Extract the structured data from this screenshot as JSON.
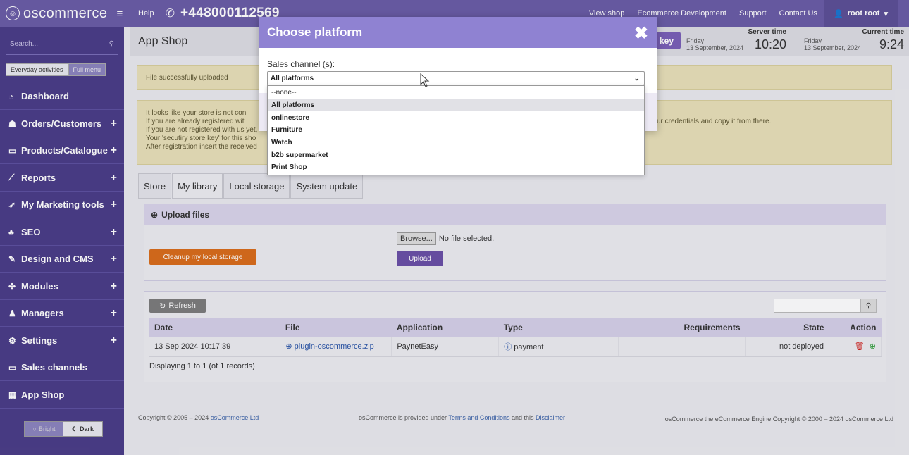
{
  "topbar": {
    "brand": "oscommerce",
    "help": "Help",
    "phone": "+448000112569",
    "links": [
      "View shop",
      "Ecommerce Development",
      "Support",
      "Contact Us"
    ],
    "user": "root root"
  },
  "sidebar": {
    "search_placeholder": "Search...",
    "menu_switch": {
      "active": "Everyday activities",
      "inactive": "Full menu"
    },
    "items": [
      {
        "label": "Dashboard",
        "icon": "dashboard-icon"
      },
      {
        "label": "Orders/Customers",
        "icon": "users-icon",
        "expandable": true
      },
      {
        "label": "Products/Catalogue",
        "icon": "folder-icon",
        "expandable": true
      },
      {
        "label": "Reports",
        "icon": "chart-line-icon",
        "expandable": true
      },
      {
        "label": "My Marketing tools",
        "icon": "rocket-icon",
        "expandable": true
      },
      {
        "label": "SEO",
        "icon": "sitemap-icon",
        "expandable": true
      },
      {
        "label": "Design and CMS",
        "icon": "brush-icon",
        "expandable": true
      },
      {
        "label": "Modules",
        "icon": "puzzle-icon",
        "expandable": true
      },
      {
        "label": "Managers",
        "icon": "user-icon",
        "expandable": true
      },
      {
        "label": "Settings",
        "icon": "cogs-icon",
        "expandable": true
      },
      {
        "label": "Sales channels",
        "icon": "monitor-icon"
      },
      {
        "label": "App Shop",
        "icon": "store-icon"
      }
    ],
    "theme": {
      "bright": "Bright",
      "dark": "Dark"
    }
  },
  "header": {
    "title": "App Shop",
    "key_button": "key",
    "server_time": {
      "label": "Server time",
      "day": "Friday",
      "date": "13 September, 2024",
      "time": "10:20"
    },
    "current_time": {
      "label": "Current time",
      "day": "Friday",
      "date": "13 September, 2024",
      "time": "9:24"
    }
  },
  "alerts": {
    "upload": "File successfully uploaded",
    "store_lines": [
      "It looks like your store is not con",
      "If you are already registered wit",
      "If you are not registered with us yet,",
      "Your 'secutiry store key' for this sho",
      "After registration insert the received"
    ],
    "store_extra": "ur credentials and copy it from there."
  },
  "tabs": [
    "Store",
    "My library",
    "Local storage",
    "System update"
  ],
  "upload_panel": {
    "title": "Upload files",
    "cleanup_button": "Cleanup my local storage",
    "browse_button": "Browse...",
    "file_status": "No file selected.",
    "upload_button": "Upload"
  },
  "list": {
    "refresh": "Refresh",
    "columns": [
      "Date",
      "File",
      "Application",
      "Type",
      "Requirements",
      "State",
      "Action"
    ],
    "rows": [
      {
        "date": "13 Sep 2024 10:17:39",
        "file": "plugin-oscommerce.zip",
        "application": "PaynetEasy",
        "type": "payment",
        "requirements": "",
        "state": "not deployed"
      }
    ],
    "display_count": "Displaying 1 to 1 (of 1 records)"
  },
  "footer": {
    "copyright_prefix": "Copyright © 2005 – 2024",
    "company": "osCommerce Ltd",
    "middle_prefix": "osCommerce is provided under",
    "terms": "Terms and Conditions",
    "middle_and": "and this",
    "disclaimer": "Disclaimer",
    "right": "osCommerce the eCommerce Engine Copyright © 2000 – 2024 osCommerce Ltd"
  },
  "modal": {
    "title": "Choose platform",
    "field_label": "Sales channel (s):",
    "selected": "All platforms",
    "options": [
      "--none--",
      "All platforms",
      "onlinestore",
      "Furniture",
      "Watch",
      "b2b supermarket",
      "Print Shop"
    ],
    "selected_index": 1
  },
  "colors": {
    "topbar": "#6a5ca6",
    "sidebar": "#4a3c87",
    "modal_header": "#8f82d2",
    "alert": "#e8e0b8",
    "orange_button": "#d96c1a",
    "purple_button": "#6a4fa6",
    "error_text": "#d0201c"
  }
}
